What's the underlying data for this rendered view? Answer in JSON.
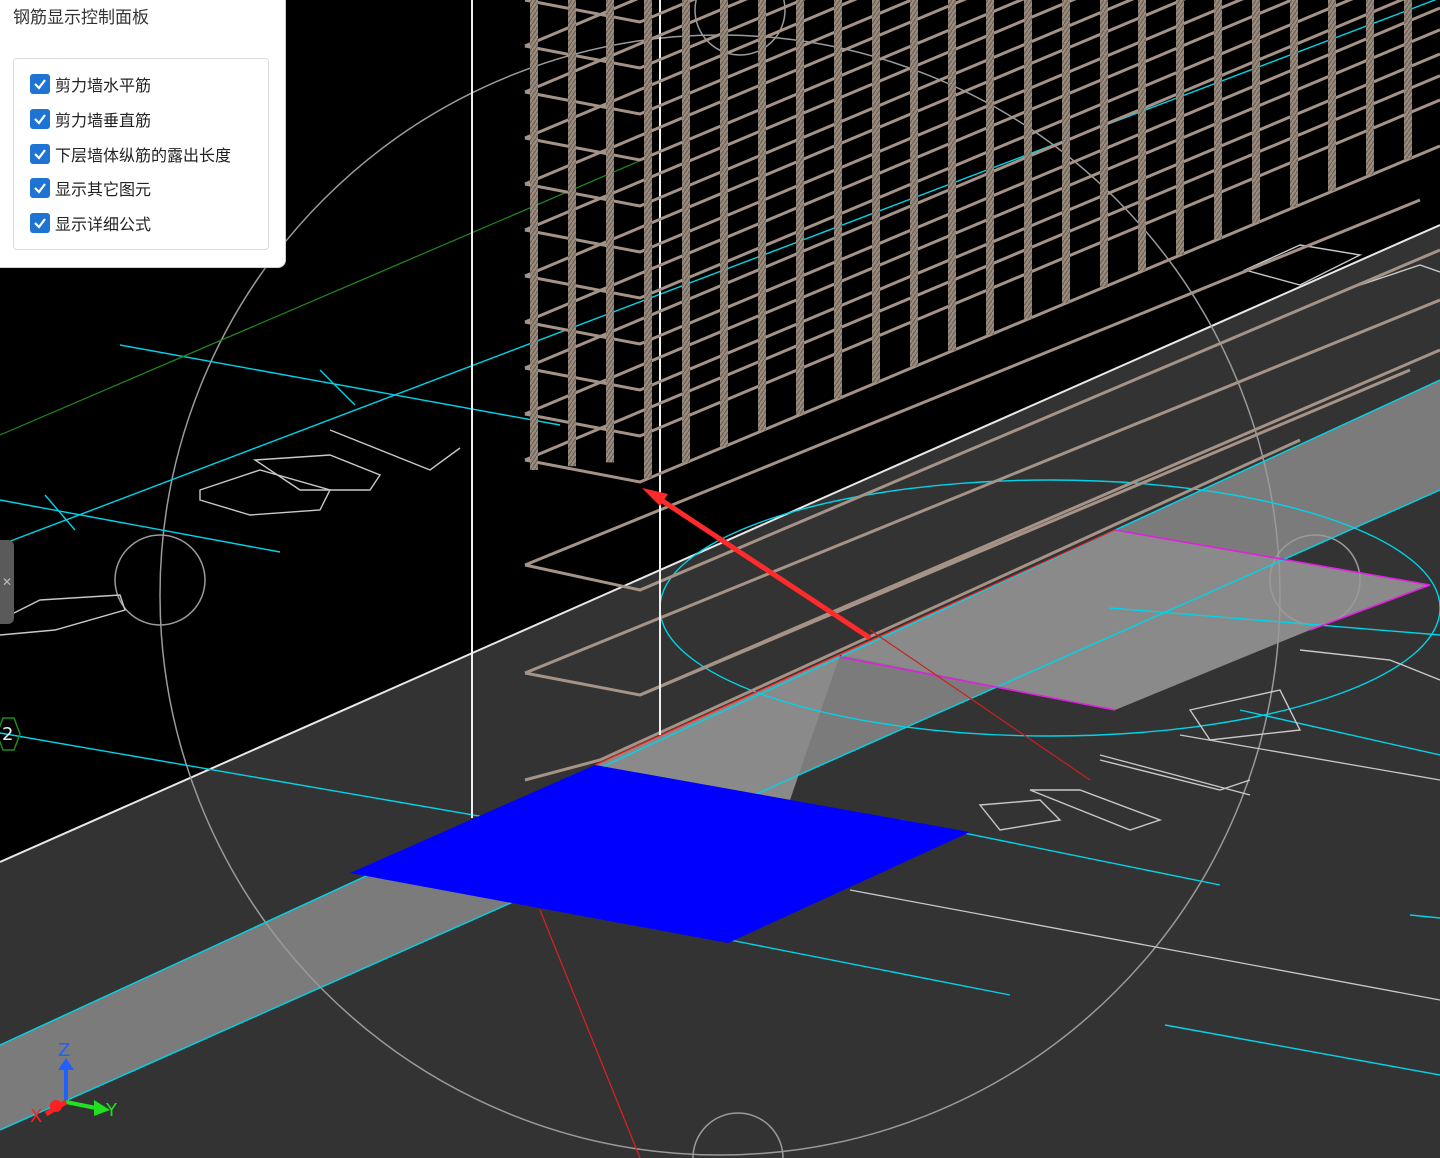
{
  "panel": {
    "title": "钢筋显示控制面板",
    "options": [
      {
        "label": "剪力墙水平筋",
        "checked": true
      },
      {
        "label": "剪力墙垂直筋",
        "checked": true
      },
      {
        "label": "下层墙体纵筋的露出长度",
        "checked": true
      },
      {
        "label": "显示其它图元",
        "checked": true
      },
      {
        "label": "显示详细公式",
        "checked": true
      }
    ]
  },
  "viewport": {
    "grid_label": "2",
    "axes": {
      "x": "X",
      "y": "Y",
      "z": "Z"
    },
    "colors": {
      "background_upper": "#000000",
      "background_lower": "#333333",
      "slab_gray": "#808080",
      "highlight_blue": "#0000ff",
      "rebar": "#a59387",
      "cyan": "#00d4e8",
      "magenta": "#e020e0",
      "arrow_red": "#ff2020"
    }
  }
}
